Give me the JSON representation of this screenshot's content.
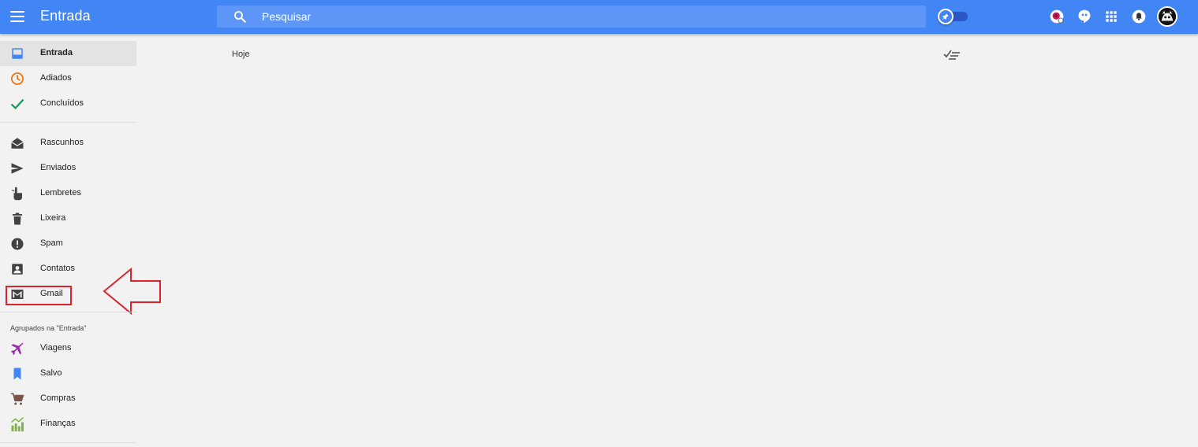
{
  "header": {
    "title": "Entrada",
    "menu_icon": "menu-icon",
    "search": {
      "placeholder": "Pesquisar",
      "value": ""
    },
    "pin_toggle": {
      "icon": "pin-icon",
      "on": true
    },
    "actions": [
      "extension-icon",
      "hangouts-icon",
      "apps-grid-icon",
      "notifications-icon"
    ],
    "accent": "#4285f4"
  },
  "sidebar": {
    "items": [
      {
        "label": "Entrada",
        "icon": "inbox-icon",
        "color": "#4285f4"
      },
      {
        "label": "Adiados",
        "icon": "clock-icon",
        "color": "#ef6c00"
      },
      {
        "label": "Concluídos",
        "icon": "check-icon",
        "color": "#0f9d58"
      },
      {
        "label": "Rascunhos",
        "icon": "drafts-icon",
        "color": "#424242"
      },
      {
        "label": "Enviados",
        "icon": "send-icon",
        "color": "#424242"
      },
      {
        "label": "Lembretes",
        "icon": "reminder-hand-icon",
        "color": "#424242"
      },
      {
        "label": "Lixeira",
        "icon": "trash-icon",
        "color": "#424242"
      },
      {
        "label": "Spam",
        "icon": "spam-icon",
        "color": "#424242"
      },
      {
        "label": "Contatos",
        "icon": "contacts-icon",
        "color": "#424242"
      },
      {
        "label": "Gmail",
        "icon": "gmail-icon",
        "color": "#424242"
      }
    ],
    "bundles_title": "Agrupados na \"Entrada\"",
    "bundles": [
      {
        "label": "Viagens",
        "icon": "airplane-icon",
        "color": "#9c27b0"
      },
      {
        "label": "Salvo",
        "icon": "bookmark-icon",
        "color": "#4285f4"
      },
      {
        "label": "Compras",
        "icon": "cart-icon",
        "color": "#795548"
      },
      {
        "label": "Finanças",
        "icon": "finance-chart-icon",
        "color": "#7cb342"
      }
    ],
    "annotation_color": "#d9252c"
  },
  "main": {
    "section_label": "Hoje",
    "sweep_icon": "sweep-done-icon"
  }
}
